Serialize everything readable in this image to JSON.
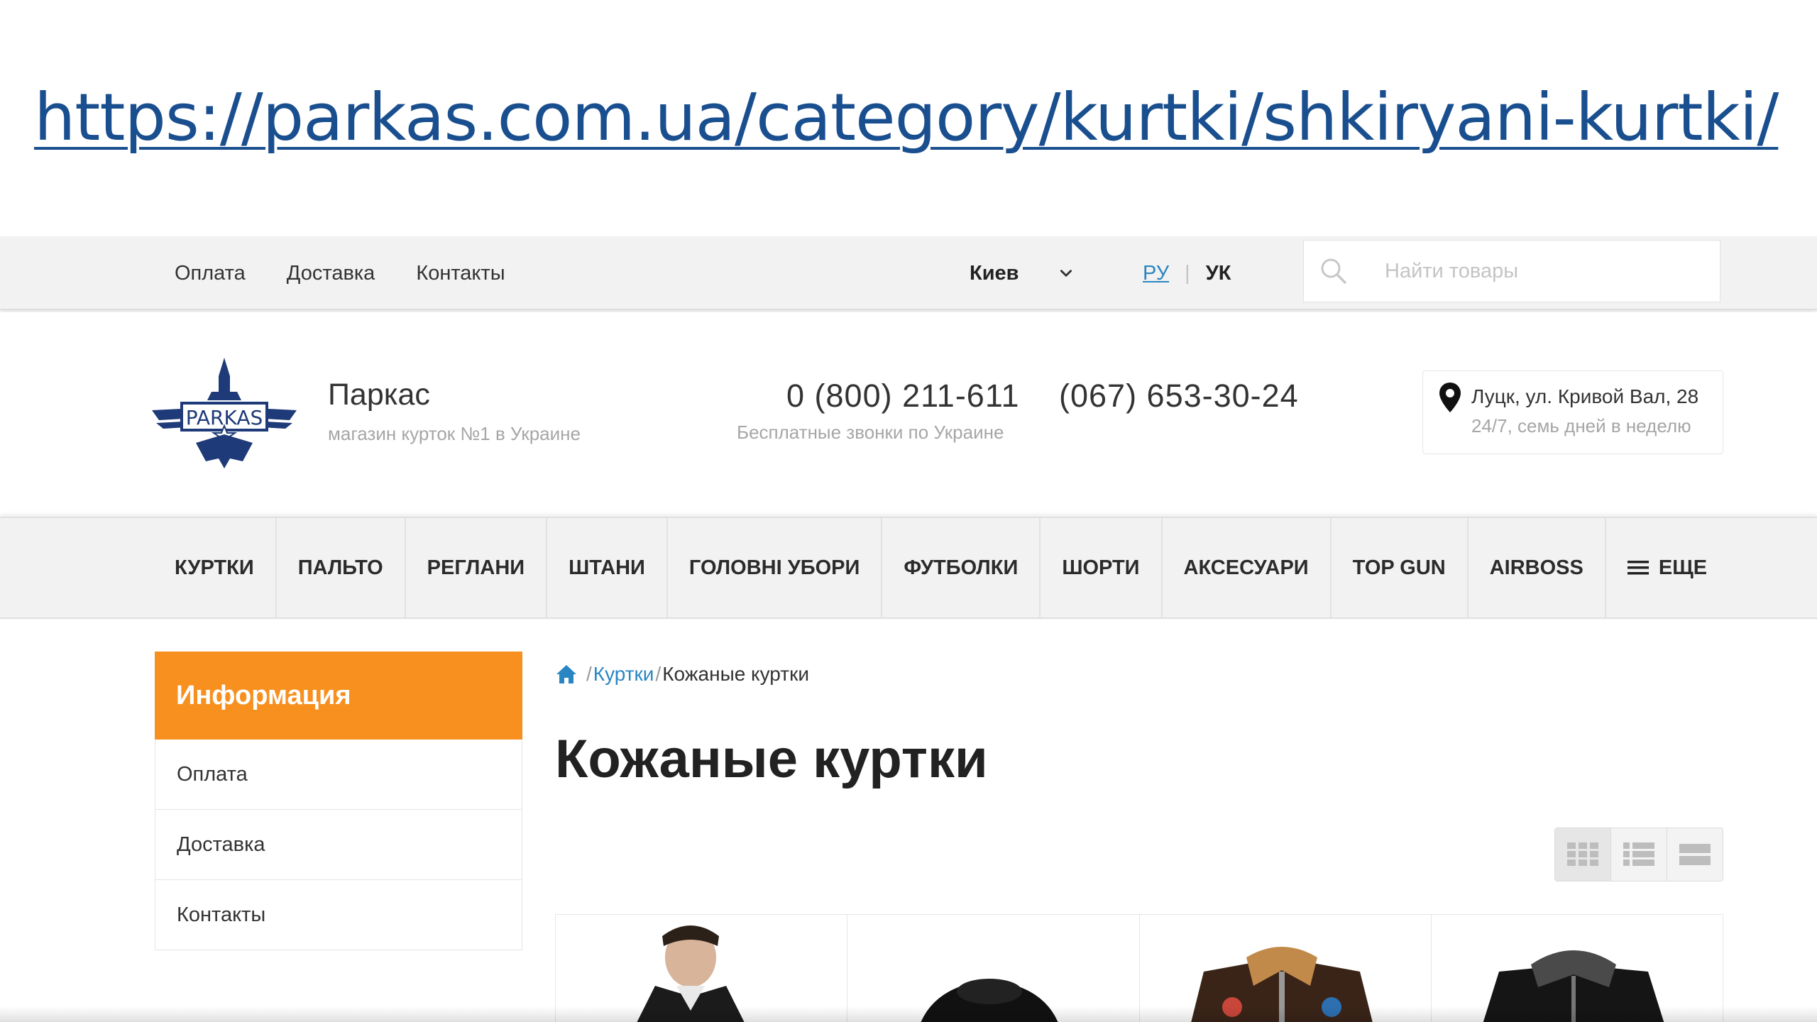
{
  "banner": {
    "url": "https://parkas.com.ua/category/kurtki/shkiryani-kurtki/"
  },
  "topbar": {
    "nav": [
      "Оплата",
      "Доставка",
      "Контакты"
    ],
    "city": "Киев",
    "lang_ru": "РУ",
    "lang_sep": "|",
    "lang_uk": "УК",
    "search_placeholder": "Найти товары"
  },
  "header": {
    "logo_text": "PARKAS",
    "brand_name": "Паркас",
    "brand_tagline": "магазин курток №1 в Украине",
    "phone_main": "0 (800) 211-611",
    "phone_note": "Бесплатные звонки по Украине",
    "phone_mobile": "(067) 653-30-24",
    "address": "Луцк, ул. Кривой Вал, 28",
    "hours": "24/7, семь дней в неделю"
  },
  "mainnav": {
    "items": [
      "КУРТКИ",
      "ПАЛЬТО",
      "РЕГЛАНИ",
      "ШТАНИ",
      "ГОЛОВНІ УБОРИ",
      "ФУТБОЛКИ",
      "ШОРТИ",
      "АКСЕСУАРИ",
      "TOP GUN",
      "AIRBOSS"
    ],
    "more": "ЕЩЕ"
  },
  "sidebar": {
    "title": "Информация",
    "items": [
      "Оплата",
      "Доставка",
      "Контакты"
    ]
  },
  "breadcrumb": {
    "sep": "/",
    "parent": "Куртки",
    "current": "Кожаные куртки"
  },
  "page": {
    "title": "Кожаные куртки"
  },
  "colors": {
    "accent_orange": "#f7901e",
    "link_blue": "#2a86c2",
    "url_blue": "#1a4f8f",
    "logo_navy": "#1f3a78"
  },
  "icons": {
    "search": "search-icon",
    "chevron": "chevron-down-icon",
    "pin": "map-pin-icon",
    "home": "home-icon",
    "menu": "menu-icon",
    "grid": "grid-view-icon",
    "list": "list-view-icon",
    "table": "table-view-icon"
  }
}
